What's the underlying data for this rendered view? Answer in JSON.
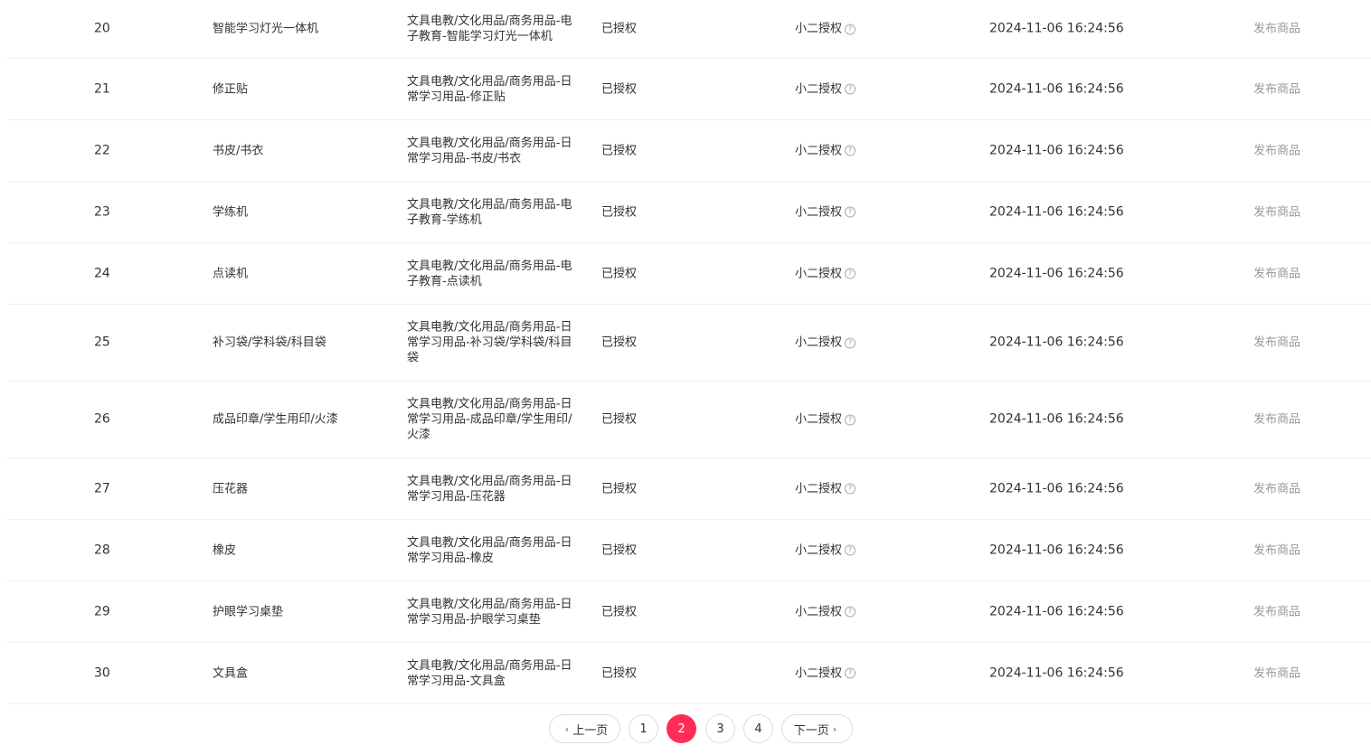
{
  "rows": [
    {
      "index": "20",
      "name": "智能学习灯光一体机",
      "category": "文具电教/文化用品/商务用品-电子教育-智能学习灯光一体机",
      "status": "已授权",
      "grant": "小二授权",
      "time": "2024-11-06 16:24:56",
      "action": "发布商品"
    },
    {
      "index": "21",
      "name": "修正贴",
      "category": "文具电教/文化用品/商务用品-日常学习用品-修正贴",
      "status": "已授权",
      "grant": "小二授权",
      "time": "2024-11-06 16:24:56",
      "action": "发布商品"
    },
    {
      "index": "22",
      "name": "书皮/书衣",
      "category": "文具电教/文化用品/商务用品-日常学习用品-书皮/书衣",
      "status": "已授权",
      "grant": "小二授权",
      "time": "2024-11-06 16:24:56",
      "action": "发布商品"
    },
    {
      "index": "23",
      "name": "学练机",
      "category": "文具电教/文化用品/商务用品-电子教育-学练机",
      "status": "已授权",
      "grant": "小二授权",
      "time": "2024-11-06 16:24:56",
      "action": "发布商品"
    },
    {
      "index": "24",
      "name": "点读机",
      "category": "文具电教/文化用品/商务用品-电子教育-点读机",
      "status": "已授权",
      "grant": "小二授权",
      "time": "2024-11-06 16:24:56",
      "action": "发布商品"
    },
    {
      "index": "25",
      "name": "补习袋/学科袋/科目袋",
      "category": "文具电教/文化用品/商务用品-日常学习用品-补习袋/学科袋/科目袋",
      "status": "已授权",
      "grant": "小二授权",
      "time": "2024-11-06 16:24:56",
      "action": "发布商品"
    },
    {
      "index": "26",
      "name": "成品印章/学生用印/火漆",
      "category": "文具电教/文化用品/商务用品-日常学习用品-成品印章/学生用印/火漆",
      "status": "已授权",
      "grant": "小二授权",
      "time": "2024-11-06 16:24:56",
      "action": "发布商品"
    },
    {
      "index": "27",
      "name": "压花器",
      "category": "文具电教/文化用品/商务用品-日常学习用品-压花器",
      "status": "已授权",
      "grant": "小二授权",
      "time": "2024-11-06 16:24:56",
      "action": "发布商品"
    },
    {
      "index": "28",
      "name": "橡皮",
      "category": "文具电教/文化用品/商务用品-日常学习用品-橡皮",
      "status": "已授权",
      "grant": "小二授权",
      "time": "2024-11-06 16:24:56",
      "action": "发布商品"
    },
    {
      "index": "29",
      "name": "护眼学习桌垫",
      "category": "文具电教/文化用品/商务用品-日常学习用品-护眼学习桌垫",
      "status": "已授权",
      "grant": "小二授权",
      "time": "2024-11-06 16:24:56",
      "action": "发布商品"
    },
    {
      "index": "30",
      "name": "文具盒",
      "category": "文具电教/文化用品/商务用品-日常学习用品-文具盒",
      "status": "已授权",
      "grant": "小二授权",
      "time": "2024-11-06 16:24:56",
      "action": "发布商品"
    }
  ],
  "help_icon_glyph": "?",
  "pagination": {
    "prev_label": "上一页",
    "next_label": "下一页",
    "pages": [
      "1",
      "2",
      "3",
      "4"
    ],
    "current": "2",
    "active_color": "#ff2d55"
  }
}
